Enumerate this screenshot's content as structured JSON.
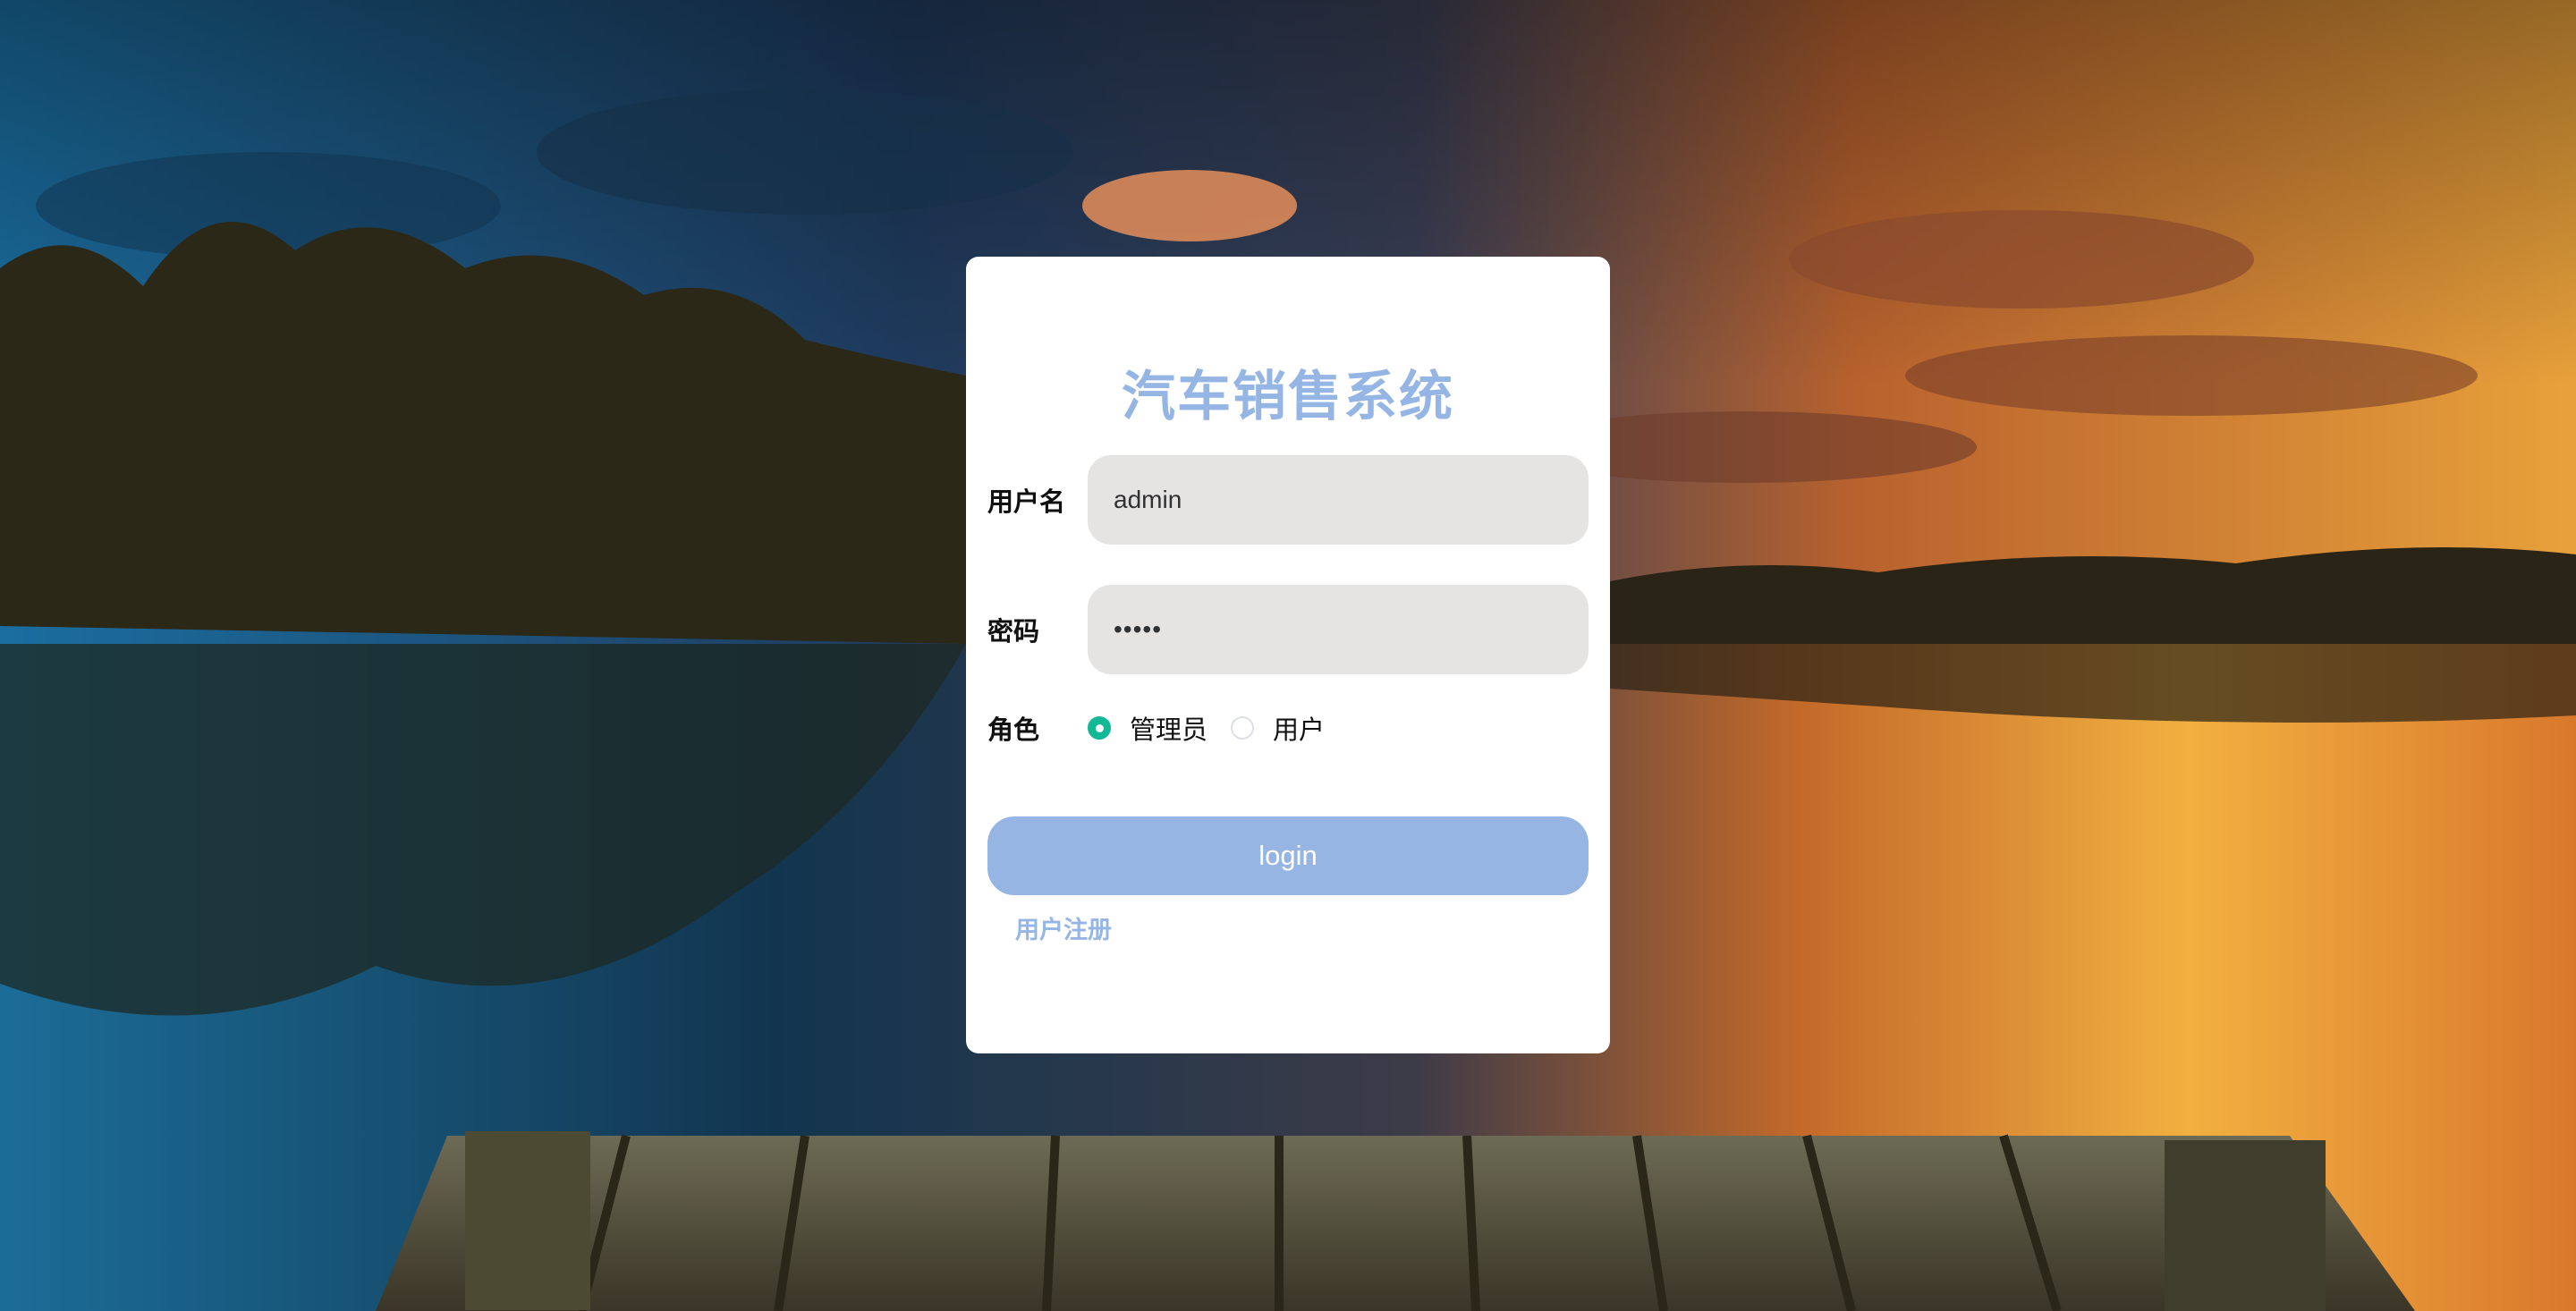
{
  "app": {
    "title": "汽车销售系统"
  },
  "form": {
    "username": {
      "label": "用户名",
      "value": "admin"
    },
    "password": {
      "label": "密码",
      "value": "•••••"
    },
    "role": {
      "label": "角色",
      "options": [
        {
          "label": "管理员",
          "checked": true
        },
        {
          "label": "用户",
          "checked": false
        }
      ]
    },
    "login_label": "login",
    "register_label": "用户注册"
  },
  "colors": {
    "accent": "#95b5e4",
    "button": "#96b5e3",
    "radio_checked": "#13b894",
    "input_bg": "#e6e3e3",
    "card_bg": "#ffffff"
  }
}
